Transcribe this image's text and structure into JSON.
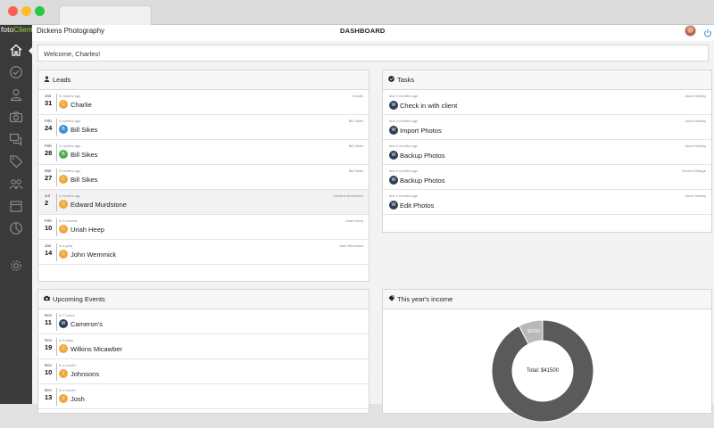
{
  "window": {
    "traffic_lights": [
      "#fe5f57",
      "#febc2e",
      "#28c840"
    ]
  },
  "sidebar": {
    "logo_foto": "foto",
    "logo_client": "Client",
    "items": [
      {
        "icon": "home-icon"
      },
      {
        "icon": "check-circle-icon"
      },
      {
        "icon": "user-icon"
      },
      {
        "icon": "camera-icon"
      },
      {
        "icon": "chat-icon"
      },
      {
        "icon": "tag-icon"
      },
      {
        "icon": "people-icon"
      },
      {
        "icon": "calendar-icon"
      },
      {
        "icon": "pie-chart-icon"
      },
      {
        "icon": "gear-icon"
      }
    ]
  },
  "header": {
    "company": "Dickens Photography",
    "title": "DASHBOARD"
  },
  "welcome": "Welcome, Charles!",
  "leads": {
    "title": "Leads",
    "rows": [
      {
        "month": "Jan",
        "day": "31",
        "meta": "5 months ago",
        "owner": "Charlie",
        "initial": "C",
        "color": "#f0a63a",
        "name": "Charlie"
      },
      {
        "month": "Feb",
        "day": "24",
        "meta": "4 months ago",
        "owner": "Bill Sikes",
        "initial": "B",
        "color": "#3a8fd8",
        "name": "Bill Sikes"
      },
      {
        "month": "Feb",
        "day": "28",
        "meta": "4 months ago",
        "owner": "Bill Sikes",
        "initial": "B",
        "color": "#4caf50",
        "name": "Bill Sikes"
      },
      {
        "month": "Mar",
        "day": "27",
        "meta": "3 months ago",
        "owner": "Bill Sikes",
        "initial": "C",
        "color": "#f0a63a",
        "name": "Bill Sikes"
      },
      {
        "month": "Jul",
        "day": "2",
        "meta": "4 months ago",
        "owner": "Edward Murdstone",
        "initial": "C",
        "color": "#f0a63a",
        "name": "Edward Murdstone"
      },
      {
        "month": "Feb",
        "day": "10",
        "meta": "in 3 months",
        "owner": "Uriah Heep",
        "initial": "C",
        "color": "#f0a63a",
        "name": "Uriah Heep"
      },
      {
        "month": "Jan",
        "day": "14",
        "meta": "in a year",
        "owner": "John Wemmick",
        "initial": "C",
        "color": "#f0a63a",
        "name": "John Wemmick"
      }
    ]
  },
  "tasks": {
    "title": "Tasks",
    "rows": [
      {
        "meta": "due 4 months ago",
        "owner": "Jacob Marley",
        "initial": "W",
        "name": "Check in with client"
      },
      {
        "meta": "due 4 months ago",
        "owner": "Jacob Marley",
        "initial": "W",
        "name": "Import Photos"
      },
      {
        "meta": "due 4 months ago",
        "owner": "Jacob Marley",
        "initial": "W",
        "name": "Backup Photos"
      },
      {
        "meta": "due 4 months ago",
        "owner": "Ernest Defarge",
        "initial": "W",
        "name": "Backup Photos"
      },
      {
        "meta": "due 4 months ago",
        "owner": "Jacob Marley",
        "initial": "W",
        "name": "Edit Photos"
      }
    ]
  },
  "events": {
    "title": "Upcoming Events",
    "rows": [
      {
        "month": "Nov",
        "day": "11",
        "meta": "in 7 hours",
        "initial": "W",
        "color": "#2f3f55",
        "name": "Cameron's"
      },
      {
        "month": "Nov",
        "day": "19",
        "meta": "in 8 days",
        "initial": "C",
        "color": "#f0a63a",
        "name": "Wilkins Micawber"
      },
      {
        "month": "Dec",
        "day": "10",
        "meta": "in a month",
        "initial": "J",
        "color": "#f0a63a",
        "name": "Johnsons"
      },
      {
        "month": "Dec",
        "day": "13",
        "meta": "in a month",
        "initial": "J",
        "color": "#f0a63a",
        "name": "Josh"
      }
    ]
  },
  "income": {
    "title": "This year's income",
    "small_label": "$3200",
    "total_label": "Total: $41500",
    "small_value": 3200,
    "total_value": 41500,
    "colors": [
      "#5a5a5a",
      "#b8b8b8"
    ]
  }
}
